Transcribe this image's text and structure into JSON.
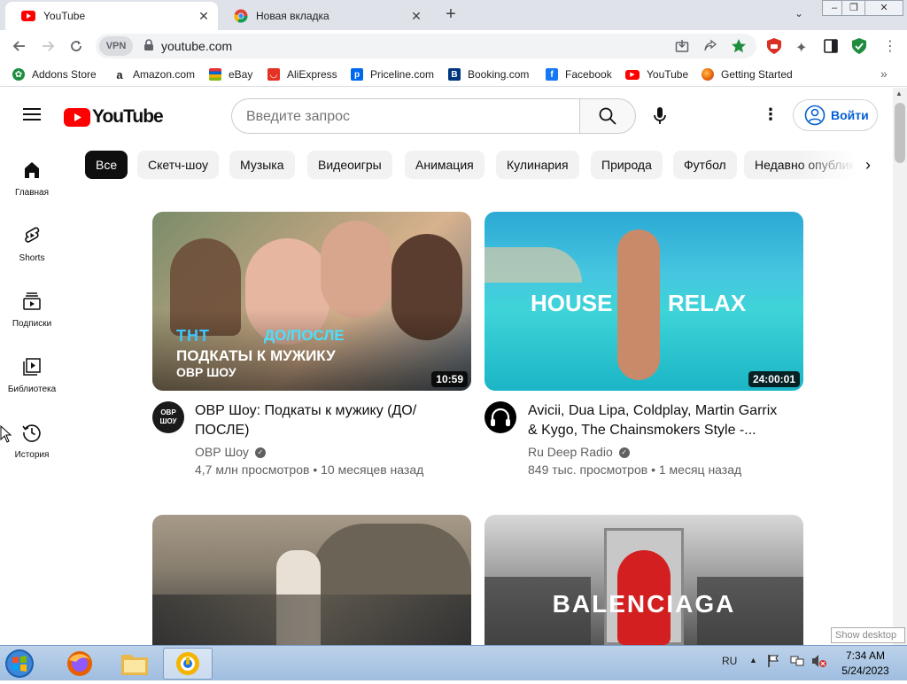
{
  "browser": {
    "tabs": [
      {
        "title": "YouTube",
        "active": true
      },
      {
        "title": "Новая вкладка",
        "active": false
      }
    ],
    "url": "youtube.com",
    "vpn_label": "VPN",
    "bookmarks": [
      {
        "label": "Addons Store",
        "icon": "addons-store-icon",
        "color": "#1e8e3e"
      },
      {
        "label": "Amazon.com",
        "icon": "amazon-icon",
        "color": "#222222"
      },
      {
        "label": "eBay",
        "icon": "ebay-icon",
        "color": "#e53238"
      },
      {
        "label": "AliExpress",
        "icon": "aliexpress-icon",
        "color": "#e43225"
      },
      {
        "label": "Priceline.com",
        "icon": "priceline-icon",
        "color": "#0068ef"
      },
      {
        "label": "Booking.com",
        "icon": "booking-icon",
        "color": "#003580"
      },
      {
        "label": "Facebook",
        "icon": "facebook-icon",
        "color": "#1877f2"
      },
      {
        "label": "YouTube",
        "icon": "youtube-icon",
        "color": "#ff0000"
      },
      {
        "label": "Getting Started",
        "icon": "firefox-icon",
        "color": "#e66000"
      }
    ]
  },
  "youtube": {
    "logo_text": "YouTube",
    "search_placeholder": "Введите запрос",
    "signin_label": "Войти",
    "chips": [
      "Все",
      "Скетч-шоу",
      "Музыка",
      "Видеоигры",
      "Анимация",
      "Кулинария",
      "Природа",
      "Футбол",
      "Недавно опубликованные"
    ],
    "guide": [
      {
        "label": "Главная",
        "icon": "home-icon"
      },
      {
        "label": "Shorts",
        "icon": "shorts-icon"
      },
      {
        "label": "Подписки",
        "icon": "subscriptions-icon"
      },
      {
        "label": "Библиотека",
        "icon": "library-icon"
      },
      {
        "label": "История",
        "icon": "history-icon"
      }
    ],
    "videos": [
      {
        "title_line1": "ОВР Шоу: Подкаты к мужику (ДО/",
        "title_line2": "ПОСЛЕ)",
        "channel": "ОВР Шоу",
        "meta": "4,7 млн просмотров • 10 месяцев назад",
        "duration": "10:59",
        "thumb_text": {
          "logo": "ТНТ",
          "tag": "ДО/ПОСЛЕ",
          "main": "ПОДКАТЫ К МУЖИКУ",
          "sub": "ОВР ШОУ"
        },
        "avatar_text": "ОВР\nШОУ"
      },
      {
        "title_line1": "Avicii, Dua Lipa, Coldplay, Martin Garrix",
        "title_line2": "& Kygo, The Chainsmokers Style -...",
        "channel": "Ru Deep Radio",
        "meta": "849 тыс. просмотров • 1 месяц назад",
        "duration": "24:00:01",
        "thumb_text": {
          "left": "HOUSE",
          "right": "RELAX"
        }
      },
      {
        "title_line1": "",
        "channel": "",
        "meta": "",
        "thumb_text": {}
      },
      {
        "title_line1": "",
        "channel": "",
        "meta": "",
        "thumb_text": {
          "main": "BALENCIAGA"
        }
      }
    ]
  },
  "taskbar": {
    "lang": "RU",
    "time": "7:34 AM",
    "date": "5/24/2023",
    "show_desktop": "Show desktop"
  }
}
